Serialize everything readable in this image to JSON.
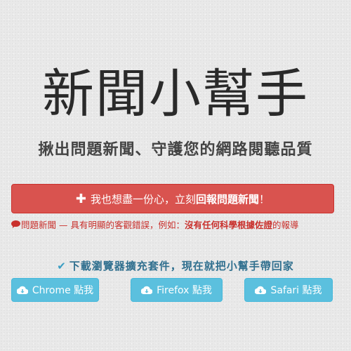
{
  "header": {
    "title": "新聞小幫手",
    "subtitle": "揪出問題新聞、守護您的網路閱聽品質"
  },
  "report": {
    "icon": "plus-icon",
    "label_prefix": "我也想盡一份心，立刻",
    "label_strong": "回報問題新聞",
    "label_suffix": "！"
  },
  "note": {
    "icon": "comment-icon",
    "text": "問題新聞 — 具有明顯的客觀錯誤，例如：",
    "strong": "沒有任何科學根據佐證",
    "suffix": "的報導"
  },
  "download": {
    "icon": "check-icon",
    "text": "下載瀏覽器擴充套件，現在就把小幫手帶回家",
    "buttons": [
      {
        "icon": "cloud-download-icon",
        "label": "Chrome 點我"
      },
      {
        "icon": "cloud-download-icon",
        "label": "Firefox 點我"
      },
      {
        "icon": "cloud-download-icon",
        "label": "Safari 點我"
      }
    ]
  },
  "colors": {
    "danger": "#d9534f",
    "info": "#5bc0de",
    "accent_text": "#31708f"
  }
}
